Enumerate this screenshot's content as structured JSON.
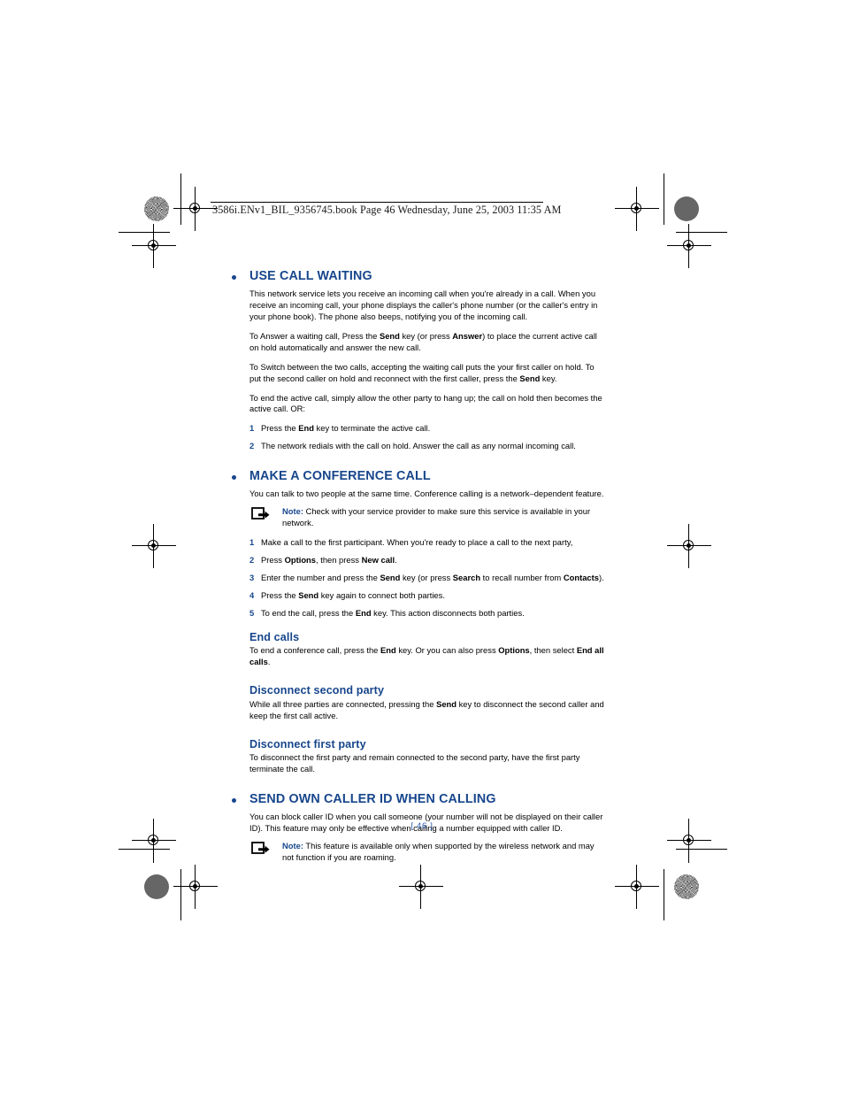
{
  "document": {
    "header_line": "3586i.ENv1_BIL_9356745.book  Page 46  Wednesday, June 25, 2003  11:35 AM",
    "page_number": "[ 46 ]",
    "note_label": "Note:"
  },
  "sections": [
    {
      "title": "USE CALL WAITING",
      "paragraphs": [
        "This network service lets you receive an incoming call when you're already in a call. When you receive an incoming call, your phone displays the caller's phone number (or the caller's entry in your phone book). The phone also beeps, notifying you of the incoming call.",
        "To Answer a waiting call, Press the Send key (or press Answer) to place the current active call on hold automatically and answer the new call.",
        "To Switch between the two calls, accepting the waiting call puts the your first caller on hold. To put the second caller on hold and reconnect with the first caller, press the Send key.",
        "To end the active call, simply allow the other party to hang up; the call on hold then becomes the active call. OR:"
      ],
      "steps": [
        {
          "num": "1",
          "text": "Press the End key to terminate the active call."
        },
        {
          "num": "2",
          "text": "The network redials with the call on hold. Answer the call as any normal incoming call."
        }
      ]
    },
    {
      "title": "MAKE A CONFERENCE CALL",
      "intro": "You can talk to two people at the same time. Conference calling is a network–dependent feature.",
      "note": "Check with your service provider to make sure this service is available in your network.",
      "steps": [
        {
          "num": "1",
          "text": "Make a call to the first participant. When you're ready to place a call to the next party,"
        },
        {
          "num": "2",
          "text": "Press Options, then press New call."
        },
        {
          "num": "3",
          "text": "Enter the number and press the Send key (or press Search to recall number from Contacts)."
        },
        {
          "num": "4",
          "text": "Press the Send key again to connect both parties."
        },
        {
          "num": "5",
          "text": "To end the call, press the End key. This action disconnects both parties."
        }
      ],
      "subsections": [
        {
          "heading": "End calls",
          "body": "To end a conference call, press the End key. Or you can also press Options, then select End all calls."
        },
        {
          "heading": "Disconnect second party",
          "body": "While all three parties are connected, pressing the Send key to disconnect the second caller and keep the first call active."
        },
        {
          "heading": "Disconnect first party",
          "body": "To disconnect the first party and remain connected to the second party, have the first party terminate the call."
        }
      ]
    },
    {
      "title": "SEND OWN CALLER ID WHEN CALLING",
      "intro": "You can block caller ID when you call someone (your number will not be displayed on their caller ID). This feature may only be effective when calling a number equipped with caller ID.",
      "note": "This feature is available only when supported by the wireless network and may not function if you are roaming."
    }
  ],
  "colors": {
    "heading_blue": "#17468c",
    "page_number_blue": "#2b5ba8",
    "text_black": "#000000"
  }
}
